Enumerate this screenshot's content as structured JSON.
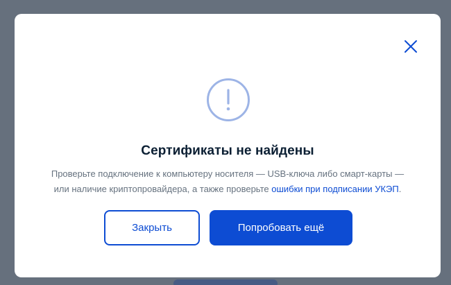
{
  "dialog": {
    "title": "Сертификаты не найдены",
    "description": {
      "line1": "Проверьте подключение к компьютеру носителя — USB-ключа либо смарт-карты —",
      "line2_prefix": "или наличие криптопровайдера, а также проверьте ",
      "link": "ошибки при подписании УКЭП",
      "line2_suffix": "."
    },
    "buttons": {
      "close_label": "Закрыть",
      "retry_label": "Попробовать ещё"
    },
    "icons": {
      "close": "close-icon",
      "alert": "exclamation-circle-icon"
    }
  },
  "colors": {
    "accent": "#0d4cd3",
    "title": "#0b1f33",
    "text": "#66727f",
    "icon": "#9db4e6",
    "backdrop": "#66707d"
  }
}
